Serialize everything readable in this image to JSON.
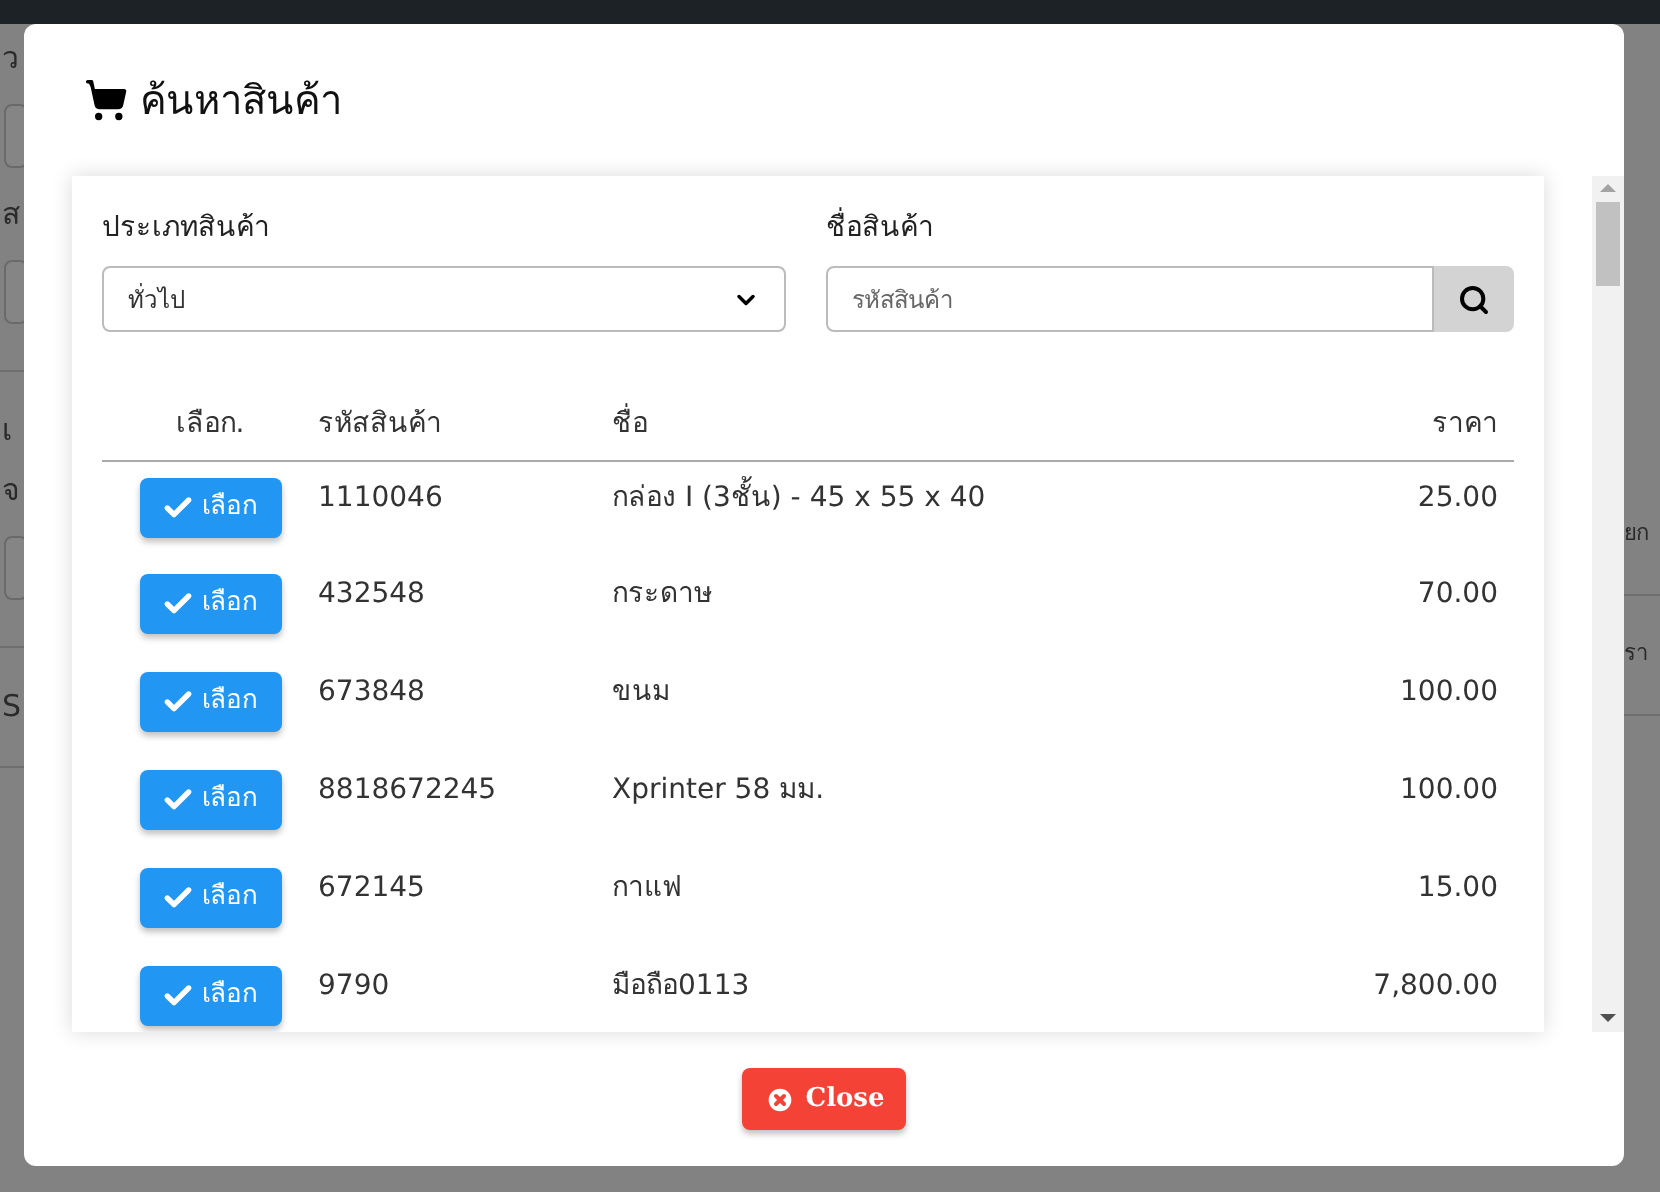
{
  "background": {
    "left_fragments": [
      {
        "kind": "label",
        "text": "ว"
      },
      {
        "kind": "input"
      },
      {
        "kind": "label",
        "text": "ส"
      },
      {
        "kind": "input"
      },
      {
        "kind": "rule"
      },
      {
        "kind": "label",
        "text": "เ"
      },
      {
        "kind": "label",
        "text": "จ"
      },
      {
        "kind": "input"
      },
      {
        "kind": "rule"
      },
      {
        "kind": "label",
        "text": "S"
      },
      {
        "kind": "rule"
      }
    ],
    "right_fragments": [
      {
        "kind": "label",
        "text": "ยก"
      },
      {
        "kind": "rule"
      },
      {
        "kind": "label",
        "text": "รา"
      },
      {
        "kind": "rule"
      }
    ]
  },
  "modal": {
    "title": "ค้นหาสินค้า",
    "filters": {
      "category_label": "ประเภทสินค้า",
      "category_value": "ทั่วไป",
      "name_label": "ชื่อสินค้า",
      "name_placeholder": "รหัสสินค้า"
    },
    "table": {
      "columns": [
        "เลือก.",
        "รหัสสินค้า",
        "ชื่อ",
        "ราคา"
      ],
      "rows": [
        {
          "select": "เลือก",
          "code": "1110046",
          "name": "กล่อง I (3ชั้น) - 45 x 55 x 40",
          "price": "25.00"
        },
        {
          "select": "เลือก",
          "code": "432548",
          "name": "กระดาษ",
          "price": "70.00"
        },
        {
          "select": "เลือก",
          "code": "673848",
          "name": "ขนม",
          "price": "100.00"
        },
        {
          "select": "เลือก",
          "code": "8818672245",
          "name": "Xprinter 58 มม.",
          "price": "100.00"
        },
        {
          "select": "เลือก",
          "code": "672145",
          "name": "กาแฟ",
          "price": "15.00"
        },
        {
          "select": "เลือก",
          "code": "9790",
          "name": "มือถือ0113",
          "price": "7,800.00"
        }
      ]
    },
    "close_button": "Close"
  }
}
